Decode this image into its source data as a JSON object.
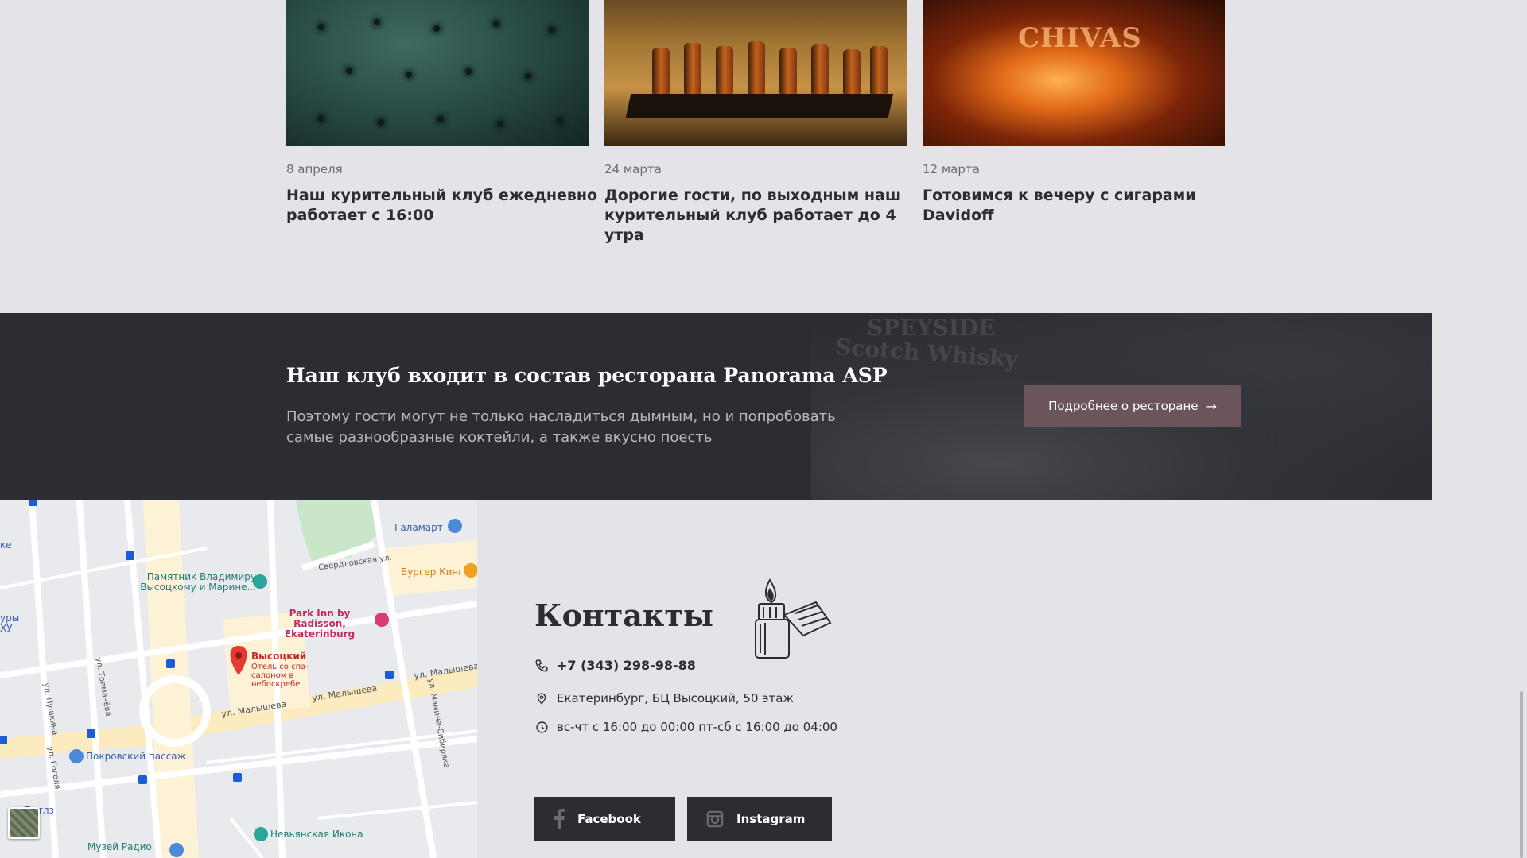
{
  "news": [
    {
      "date": "8 апреля",
      "title": "Наш курительный клуб ежедневно работает с 16:00"
    },
    {
      "date": "24 марта",
      "title": "Дорогие гости, по выходным наш курительный клуб работает до 4 утра"
    },
    {
      "date": "12 марта",
      "title": "Готовимся к вечеру с сигарами Davidoff"
    }
  ],
  "news_images": {
    "third_brand": "CHIVAS"
  },
  "banner": {
    "title": "Наш клуб входит в состав ресторана Panorama ASP",
    "text": "Поэтому гости могут не только насладиться дымным, но и попробовать самые разнообразные коктейли, а также вкусно поесть",
    "button_label": "Подробнее о ресторане",
    "button_arrow": "→",
    "bg_text_1": "SPEYSIDE",
    "bg_text_2": "Scotch Whisky"
  },
  "map": {
    "labels": {
      "galamart": "Галамарт",
      "burger_king": "Бургер Кинг",
      "vysotsky_monument": "Памятник Владимиру Высоцкому и Марине...",
      "park_inn": "Park Inn by Radisson, Ekaterinburg",
      "vysotsky": "Высоцкий",
      "vysotsky_sub": "Отель со спа-салоном в небоскребе",
      "pokrovsky": "Покровский пассаж",
      "beatles": "ле Битлз",
      "museum_radio": "Музей Радио",
      "nevyanskaya": "Невьянская Икона",
      "street_malysheva_1": "ул. Малышева",
      "street_malysheva_2": "ул. Малышева",
      "street_malysheva_3": "ул. Малышева",
      "street_sverdlovskaya": "Свердловская ул.",
      "street_tolmacheva": "ул. Толмачёва",
      "street_pushkina": "ул. Пушкина",
      "street_gogolya": "ул. Гоголя",
      "street_mamina": "ул. Мамина-Сибиряка",
      "edge_1": "уры",
      "edge_2": "ХУ",
      "edge_3": "ке"
    }
  },
  "contacts": {
    "title": "Контакты",
    "phone": "+7 (343) 298-98-88",
    "address": "Екатеринбург, БЦ Высоцкий, 50 этаж",
    "hours": "вс-чт с 16:00 до 00:00 пт-сб с 16:00 до 04:00"
  },
  "social": {
    "facebook": "Facebook",
    "instagram": "Instagram"
  },
  "icons": {
    "phone": "phone-icon",
    "pin": "map-pin-icon",
    "clock": "clock-icon",
    "facebook": "facebook-icon",
    "instagram": "instagram-icon",
    "lighter": "lighter-icon"
  },
  "colors": {
    "page_bg": "#e3e3e8",
    "dark": "#2b2d33",
    "button": "#6b555b"
  }
}
